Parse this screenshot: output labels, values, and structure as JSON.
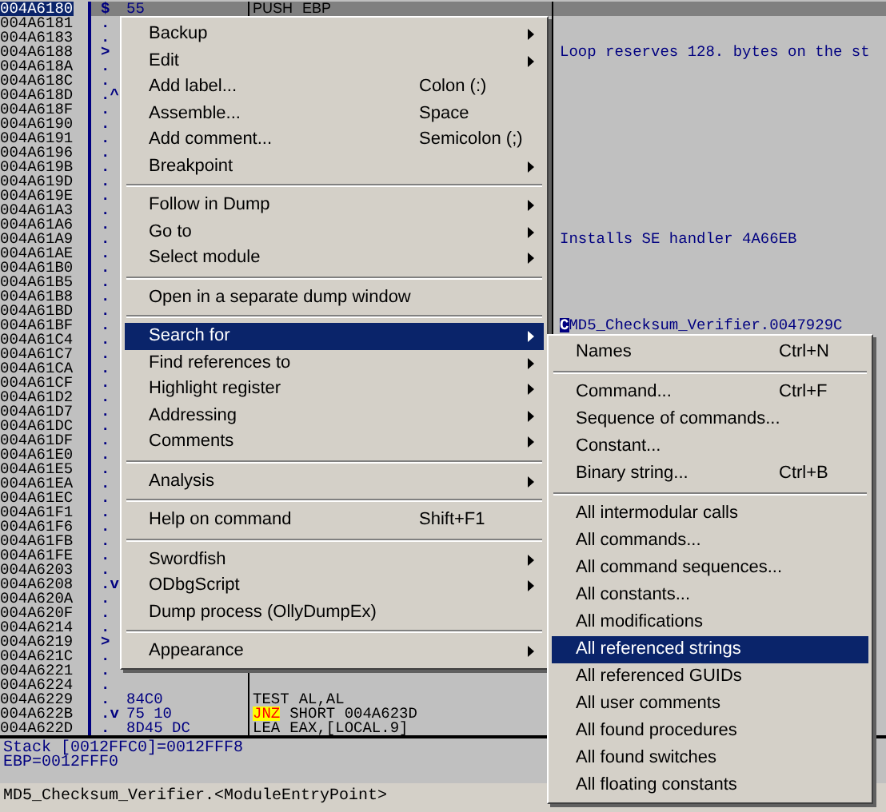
{
  "rows": [
    {
      "address": "004A6180",
      "marker": "$",
      "hex": "55",
      "mnemonic": "PUSH",
      "operands": "EBP",
      "selected": true,
      "jump": false
    },
    {
      "address": "004A6181",
      "marker": ".",
      "selected": false
    },
    {
      "address": "004A6183",
      "marker": ".",
      "selected": false
    },
    {
      "address": "004A6188",
      "marker": ">",
      "comment": "Loop reserves 128. bytes on the st",
      "selected": false
    },
    {
      "address": "004A618A",
      "marker": ".",
      "selected": false
    },
    {
      "address": "004A618C",
      "marker": ".",
      "selected": false
    },
    {
      "address": "004A618D",
      "marker": ".^",
      "selected": false
    },
    {
      "address": "004A618F",
      "marker": ".",
      "selected": false
    },
    {
      "address": "004A6190",
      "marker": ".",
      "selected": false
    },
    {
      "address": "004A6191",
      "marker": ".",
      "selected": false
    },
    {
      "address": "004A6196",
      "marker": ".",
      "selected": false
    },
    {
      "address": "004A619B",
      "marker": ".",
      "selected": false
    },
    {
      "address": "004A619D",
      "marker": ".",
      "selected": false
    },
    {
      "address": "004A619E",
      "marker": ".",
      "selected": false
    },
    {
      "address": "004A61A3",
      "marker": ".",
      "selected": false
    },
    {
      "address": "004A61A6",
      "marker": ".",
      "selected": false
    },
    {
      "address": "004A61A9",
      "marker": ".",
      "comment": "Installs SE handler 4A66EB",
      "selected": false
    },
    {
      "address": "004A61AE",
      "marker": ".",
      "selected": false
    },
    {
      "address": "004A61B0",
      "marker": ".",
      "selected": false
    },
    {
      "address": "004A61B5",
      "marker": ".",
      "selected": false
    },
    {
      "address": "004A61B8",
      "marker": ".",
      "selected": false
    },
    {
      "address": "004A61BD",
      "marker": ".",
      "selected": false
    },
    {
      "address": "004A61BF",
      "marker": ".",
      "comment_tag": "C",
      "comment": "MD5_Checksum_Verifier.0047929C",
      "selected": false
    },
    {
      "address": "004A61C4",
      "marker": ".",
      "selected": false
    },
    {
      "address": "004A61C7",
      "marker": ".",
      "selected": false
    },
    {
      "address": "004A61CA",
      "marker": ".",
      "selected": false
    },
    {
      "address": "004A61CF",
      "marker": ".",
      "selected": false
    },
    {
      "address": "004A61D2",
      "marker": ".",
      "selected": false
    },
    {
      "address": "004A61D7",
      "marker": ".",
      "selected": false
    },
    {
      "address": "004A61DC",
      "marker": ".",
      "selected": false
    },
    {
      "address": "004A61DF",
      "marker": ".",
      "selected": false
    },
    {
      "address": "004A61E0",
      "marker": ".",
      "selected": false
    },
    {
      "address": "004A61E5",
      "marker": ".",
      "selected": false
    },
    {
      "address": "004A61EA",
      "marker": ".",
      "selected": false
    },
    {
      "address": "004A61EC",
      "marker": ".",
      "selected": false
    },
    {
      "address": "004A61F1",
      "marker": ".",
      "selected": false
    },
    {
      "address": "004A61F6",
      "marker": ".",
      "selected": false
    },
    {
      "address": "004A61FB",
      "marker": ".",
      "selected": false
    },
    {
      "address": "004A61FE",
      "marker": ".",
      "selected": false
    },
    {
      "address": "004A6203",
      "marker": ".",
      "selected": false
    },
    {
      "address": "004A6208",
      "marker": ".v",
      "selected": false
    },
    {
      "address": "004A620A",
      "marker": ".",
      "selected": false
    },
    {
      "address": "004A620F",
      "marker": ".",
      "selected": false
    },
    {
      "address": "004A6214",
      "marker": ".",
      "selected": false
    },
    {
      "address": "004A6219",
      "marker": ">",
      "selected": false
    },
    {
      "address": "004A621C",
      "marker": ".",
      "selected": false
    },
    {
      "address": "004A6221",
      "marker": ".",
      "selected": false
    },
    {
      "address": "004A6224",
      "marker": ".",
      "selected": false
    },
    {
      "address": "004A6229",
      "marker": ".",
      "hex": "84C0",
      "mnemonic": "TEST",
      "operands": "AL,AL",
      "selected": false,
      "jump": false
    },
    {
      "address": "004A622B",
      "marker": ".v",
      "hex": "75 10",
      "mnemonic": "JNZ",
      "operands": "SHORT 004A623D",
      "selected": false,
      "jump": true
    },
    {
      "address": "004A622D",
      "marker": ".",
      "hex": "8D45 DC",
      "mnemonic": "LEA",
      "operands": "EAX,[LOCAL.9]",
      "selected": false,
      "jump": false
    }
  ],
  "info_pane": [
    "Stack [0012FFC0]=0012FFF8",
    "EBP=0012FFF0"
  ],
  "status_bar": "MD5_Checksum_Verifier.<ModuleEntryPoint>",
  "context_menu": [
    {
      "kind": "item",
      "label": "Backup",
      "submenu": true,
      "selected": false
    },
    {
      "kind": "item",
      "label": "Edit",
      "submenu": true,
      "selected": false
    },
    {
      "kind": "item",
      "label": "Add label...",
      "shortcut": "Colon (:)",
      "selected": false
    },
    {
      "kind": "item",
      "label": "Assemble...",
      "shortcut": "Space",
      "selected": false
    },
    {
      "kind": "item",
      "label": "Add comment...",
      "shortcut": "Semicolon (;)",
      "selected": false
    },
    {
      "kind": "item",
      "label": "Breakpoint",
      "submenu": true,
      "selected": false
    },
    {
      "kind": "separator"
    },
    {
      "kind": "item",
      "label": "Follow in Dump",
      "submenu": true,
      "selected": false
    },
    {
      "kind": "item",
      "label": "Go to",
      "submenu": true,
      "selected": false
    },
    {
      "kind": "item",
      "label": "Select module",
      "submenu": true,
      "selected": false
    },
    {
      "kind": "separator"
    },
    {
      "kind": "item",
      "label": "Open in a separate dump window",
      "selected": false
    },
    {
      "kind": "separator"
    },
    {
      "kind": "item",
      "label": "Search for",
      "submenu": true,
      "selected": true
    },
    {
      "kind": "item",
      "label": "Find references to",
      "submenu": true,
      "selected": false
    },
    {
      "kind": "item",
      "label": "Highlight register",
      "submenu": true,
      "selected": false
    },
    {
      "kind": "item",
      "label": "Addressing",
      "submenu": true,
      "selected": false
    },
    {
      "kind": "item",
      "label": "Comments",
      "submenu": true,
      "selected": false
    },
    {
      "kind": "separator"
    },
    {
      "kind": "item",
      "label": "Analysis",
      "submenu": true,
      "selected": false
    },
    {
      "kind": "separator"
    },
    {
      "kind": "item",
      "label": "Help on command",
      "shortcut": "Shift+F1",
      "selected": false
    },
    {
      "kind": "separator"
    },
    {
      "kind": "item",
      "label": "Swordfish",
      "submenu": true,
      "selected": false
    },
    {
      "kind": "item",
      "label": "ODbgScript",
      "submenu": true,
      "selected": false
    },
    {
      "kind": "item",
      "label": "Dump process (OllyDumpEx)",
      "selected": false
    },
    {
      "kind": "separator"
    },
    {
      "kind": "item",
      "label": "Appearance",
      "submenu": true,
      "selected": false
    }
  ],
  "search_submenu": [
    {
      "kind": "item",
      "label": "Names",
      "shortcut": "Ctrl+N",
      "selected": false
    },
    {
      "kind": "separator"
    },
    {
      "kind": "item",
      "label": "Command...",
      "shortcut": "Ctrl+F",
      "selected": false
    },
    {
      "kind": "item",
      "label": "Sequence of commands...",
      "selected": false
    },
    {
      "kind": "item",
      "label": "Constant...",
      "selected": false
    },
    {
      "kind": "item",
      "label": "Binary string...",
      "shortcut": "Ctrl+B",
      "selected": false
    },
    {
      "kind": "separator"
    },
    {
      "kind": "item",
      "label": "All intermodular calls",
      "selected": false
    },
    {
      "kind": "item",
      "label": "All commands...",
      "selected": false
    },
    {
      "kind": "item",
      "label": "All command sequences...",
      "selected": false
    },
    {
      "kind": "item",
      "label": "All constants...",
      "selected": false
    },
    {
      "kind": "item",
      "label": "All modifications",
      "selected": false
    },
    {
      "kind": "item",
      "label": "All referenced strings",
      "selected": true
    },
    {
      "kind": "item",
      "label": "All referenced GUIDs",
      "selected": false
    },
    {
      "kind": "item",
      "label": "All user comments",
      "selected": false
    },
    {
      "kind": "item",
      "label": "All found procedures",
      "selected": false
    },
    {
      "kind": "item",
      "label": "All found switches",
      "selected": false
    },
    {
      "kind": "item",
      "label": "All floating constants",
      "selected": false
    }
  ]
}
